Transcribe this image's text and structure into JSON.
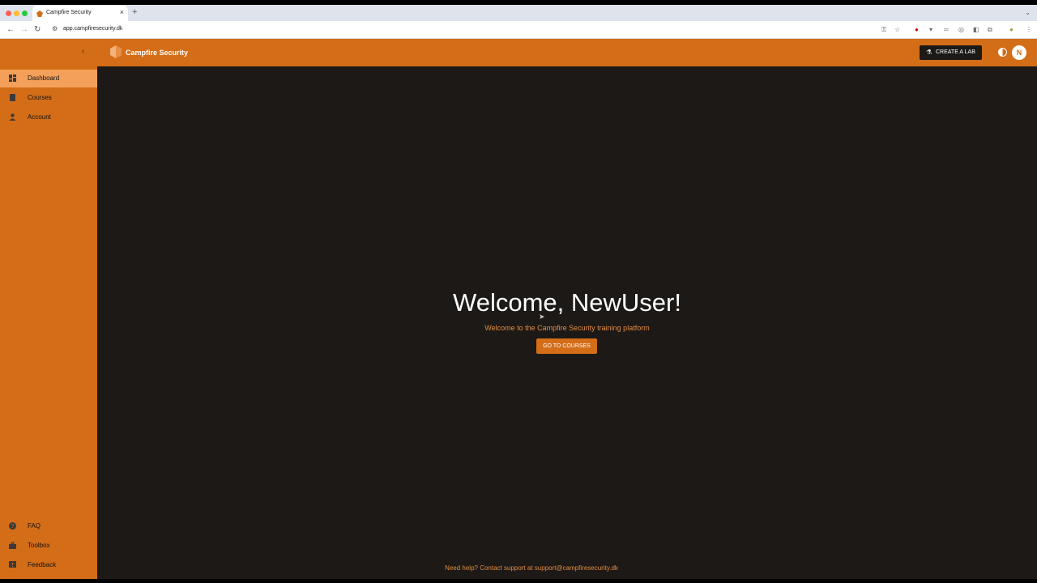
{
  "browser": {
    "tab_title": "Campfire Security",
    "url": "app.campfiresecurity.dk",
    "new_tab": "+",
    "close": "×"
  },
  "app": {
    "brand": "Campfire Security",
    "create_lab": "CREATE A LAB",
    "avatar_initial": "N",
    "accent": "#d46d17"
  },
  "sidebar": {
    "top_items": [
      {
        "label": "Dashboard",
        "icon": "dashboard-icon",
        "active": true
      },
      {
        "label": "Courses",
        "icon": "book-icon",
        "active": false
      },
      {
        "label": "Account",
        "icon": "person-icon",
        "active": false
      }
    ],
    "bottom_items": [
      {
        "label": "FAQ",
        "icon": "help-icon"
      },
      {
        "label": "Toolbox",
        "icon": "toolbox-icon"
      },
      {
        "label": "Feedback",
        "icon": "feedback-icon"
      }
    ]
  },
  "main": {
    "heading": "Welcome, NewUser!",
    "subtitle": "Welcome to the Campfire Security training platform",
    "cta": "GO TO COURSES",
    "support": "Need help? Contact support at support@campfiresecurity.dk"
  }
}
